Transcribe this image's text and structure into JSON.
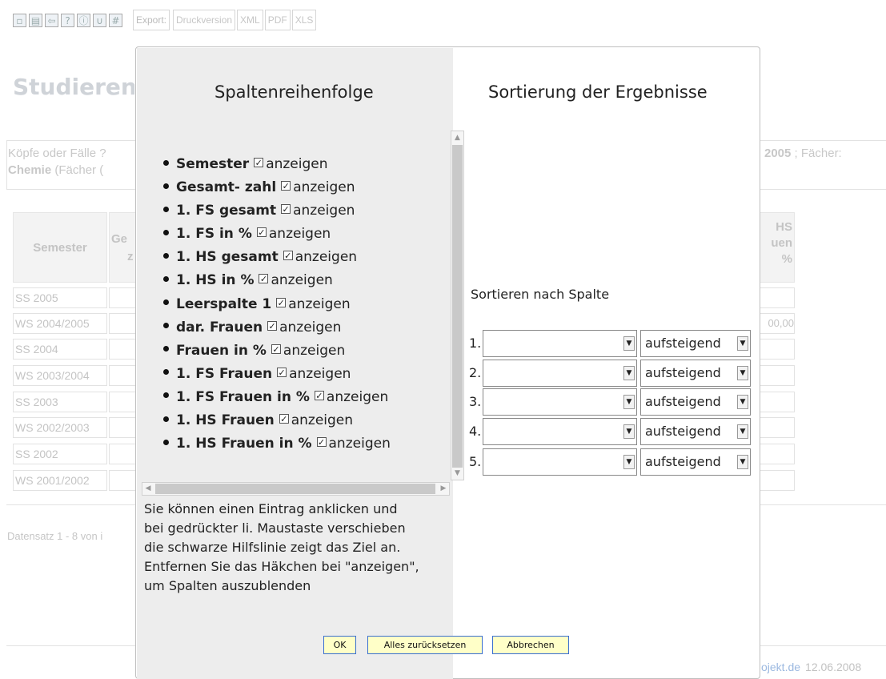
{
  "toolbar": {
    "icons": [
      "save-icon",
      "print-icon",
      "back-icon",
      "help-icon",
      "info-icon",
      "attachment-icon",
      "grid-icon"
    ],
    "export_label": "Export:",
    "links": [
      "Druckversion",
      "XML",
      "PDF",
      "XLS"
    ]
  },
  "background": {
    "title": "Studieren",
    "filter_line1": "Köpfe oder Fälle ?",
    "filter_line2_bold": "Chemie",
    "filter_line2_rest": " (Fächer (",
    "filter_right_bold": "2005",
    "filter_right_rest": " ; Fächer:",
    "table_header_semester": "Semester",
    "table_header_col2_line1": "Ge",
    "table_header_col2_line2": "z",
    "table_header_last_line1": "HS",
    "table_header_last_line2": "uen",
    "table_header_last_line3": "%",
    "rows": [
      "SS 2005",
      "WS 2004/2005",
      "SS 2004",
      "WS 2003/2004",
      "SS 2003",
      "WS 2002/2003",
      "SS 2002",
      "WS 2001/2002"
    ],
    "row2_last_value": "00,00",
    "datensatz": "Datensatz 1 - 8 von i",
    "footer_link": "ojekt.de",
    "footer_date": "12.06.2008"
  },
  "dialog": {
    "title_columns": "Spaltenreihenfolge",
    "title_sort": "Sortierung der Ergebnisse",
    "show_label": "anzeigen",
    "columns": [
      {
        "name": "Semester",
        "checked": true
      },
      {
        "name": "Gesamt- zahl",
        "checked": true
      },
      {
        "name": "1. FS gesamt",
        "checked": true
      },
      {
        "name": "1. FS in %",
        "checked": true
      },
      {
        "name": "1. HS gesamt",
        "checked": true
      },
      {
        "name": "1. HS in %",
        "checked": true
      },
      {
        "name": "Leerspalte 1",
        "checked": true
      },
      {
        "name": "dar. Frauen",
        "checked": true
      },
      {
        "name": "Frauen in %",
        "checked": true
      },
      {
        "name": "1. FS Frauen",
        "checked": true
      },
      {
        "name": "1. FS Frauen in %",
        "checked": true
      },
      {
        "name": "1. HS Frauen",
        "checked": true
      },
      {
        "name": "1. HS Frauen in %",
        "checked": true
      }
    ],
    "help_lines": [
      "Sie können einen Eintrag anklicken und",
      "bei gedrückter li. Maustaste verschieben",
      "die schwarze Hilfslinie zeigt das Ziel an.",
      "Entfernen Sie das Häkchen bei \"anzeigen\",",
      "um Spalten auszublenden"
    ],
    "sort_label": "Sortieren nach Spalte",
    "sort_rows": [
      {
        "num": "1.",
        "column": "",
        "direction": "aufsteigend"
      },
      {
        "num": "2.",
        "column": "",
        "direction": "aufsteigend"
      },
      {
        "num": "3.",
        "column": "",
        "direction": "aufsteigend"
      },
      {
        "num": "4.",
        "column": "",
        "direction": "aufsteigend"
      },
      {
        "num": "5.",
        "column": "",
        "direction": "aufsteigend"
      }
    ],
    "buttons": {
      "ok": "OK",
      "reset": "Alles zurücksetzen",
      "cancel": "Abbrechen"
    }
  }
}
